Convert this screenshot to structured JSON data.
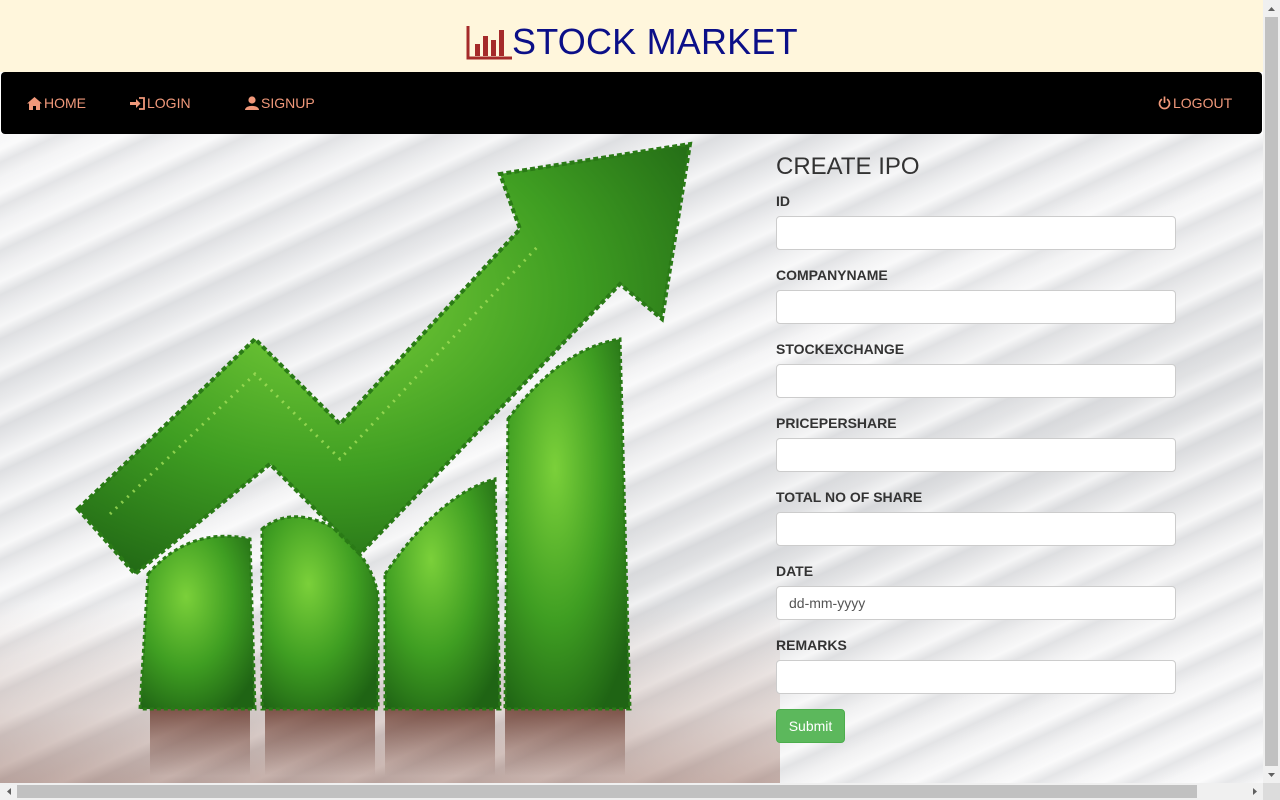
{
  "brand": {
    "title": "STOCK MARKET",
    "icon": "bar-chart-icon",
    "color": "#0b0f88",
    "icon_color": "#a52a2a"
  },
  "nav": {
    "left_items": [
      {
        "label": "HOME",
        "icon": "home-icon"
      },
      {
        "label": "LOGIN",
        "icon": "login-icon"
      },
      {
        "label": "SIGNUP",
        "icon": "user-icon"
      }
    ],
    "right_items": [
      {
        "label": "LOGOUT",
        "icon": "power-icon"
      }
    ],
    "background": "#000000",
    "link_color": "#f0987a"
  },
  "form": {
    "title": "CREATE IPO",
    "fields": [
      {
        "label": "ID",
        "value": "",
        "placeholder": ""
      },
      {
        "label": "COMPANYNAME",
        "value": "",
        "placeholder": ""
      },
      {
        "label": "STOCKEXCHANGE",
        "value": "",
        "placeholder": ""
      },
      {
        "label": "PRICEPERSHARE",
        "value": "",
        "placeholder": ""
      },
      {
        "label": "TOTAL NO OF SHARE",
        "value": "",
        "placeholder": ""
      },
      {
        "label": "DATE",
        "value": "",
        "placeholder": "dd-mm-yyyy"
      },
      {
        "label": "REMARKS",
        "value": "",
        "placeholder": ""
      }
    ],
    "submit_label": "Submit",
    "submit_color": "#5cb85c"
  },
  "hero_image": {
    "subject": "green-leaf-growth-chart-icon"
  }
}
